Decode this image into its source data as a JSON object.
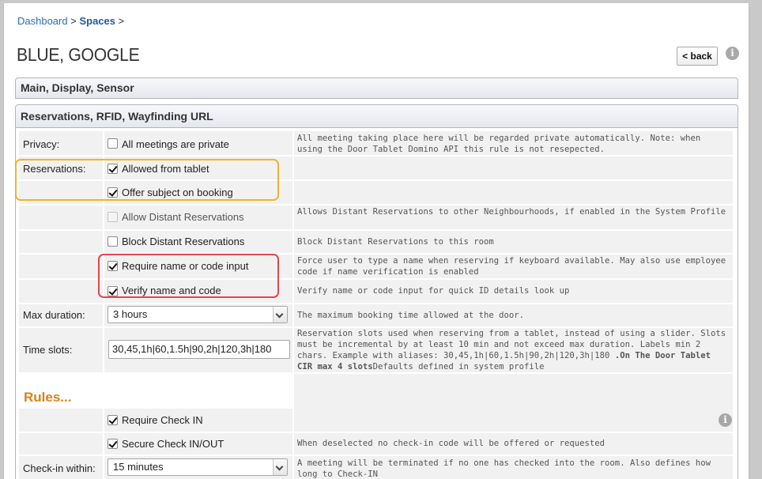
{
  "breadcrumb": {
    "dashboard": "Dashboard",
    "sep1": ">",
    "spaces": "Spaces",
    "sep2": ">"
  },
  "page": {
    "title": "BLUE, GOOGLE",
    "back_label": "< back"
  },
  "sections": {
    "main": "Main, Display, Sensor",
    "reservations": "Reservations, RFID, Wayfinding URL"
  },
  "fields": {
    "privacy": {
      "label": "Privacy:",
      "option": "All meetings are private",
      "checked": false,
      "desc": "All meeting taking place here will be regarded private automatically. Note: when using the Door Tablet Domino API this rule is not resepected."
    },
    "reservations": {
      "label": "Reservations:",
      "allowed_from_tablet": {
        "label": "Allowed from tablet",
        "checked": true
      },
      "offer_subject": {
        "label": "Offer subject on booking",
        "checked": true
      }
    },
    "allow_distant": {
      "label": "Allow Distant Reservations",
      "checked": false,
      "disabled": true,
      "desc": "Allows Distant Reservations to other Neighbourhoods, if enabled in the System Profile"
    },
    "block_distant": {
      "label": "Block Distant Reservations",
      "checked": false,
      "desc": "Block Distant Reservations to this room"
    },
    "require_name": {
      "label": "Require name or code input",
      "checked": true,
      "desc": "Force user to type a name when reserving if keyboard available. May also use employee code if name verification is enabled"
    },
    "verify_name": {
      "label": "Verify name and code",
      "checked": true,
      "desc": "Verify name or code input for quick ID details look up"
    },
    "max_duration": {
      "label": "Max duration:",
      "value": "3 hours",
      "desc": "The maximum booking time allowed at the door."
    },
    "time_slots": {
      "label": "Time slots:",
      "value": "30,45,1h|60,1.5h|90,2h|120,3h|180",
      "desc_plain": "Reservation slots used when reserving from a tablet, instead of using a slider. Slots must be incremental by at least 10 min and not exceed max duration. Labels min 2 chars. Example with aliases: 30,45,1h|60,1.5h|90,2h|120,3h|180 ",
      "desc_bold": ".On The Door Tablet CIR max 4 slots",
      "desc_tail": "Defaults defined in system profile"
    },
    "rules_title": "Rules...",
    "require_checkin": {
      "label": "Require Check IN",
      "checked": true
    },
    "secure_checkin": {
      "label": "Secure Check IN/OUT",
      "checked": true,
      "desc": "When deselected no check-in code will be offered or requested"
    },
    "checkin_within": {
      "label": "Check-in within:",
      "value": "15 minutes",
      "desc": "A meeting will be terminated if no one has checked into the room. Also defines how long to Check-IN"
    }
  },
  "colors": {
    "highlight_orange": "#f0b132",
    "highlight_red": "#e0474c",
    "rules": "#d8821b",
    "link": "#2a6ebb"
  }
}
